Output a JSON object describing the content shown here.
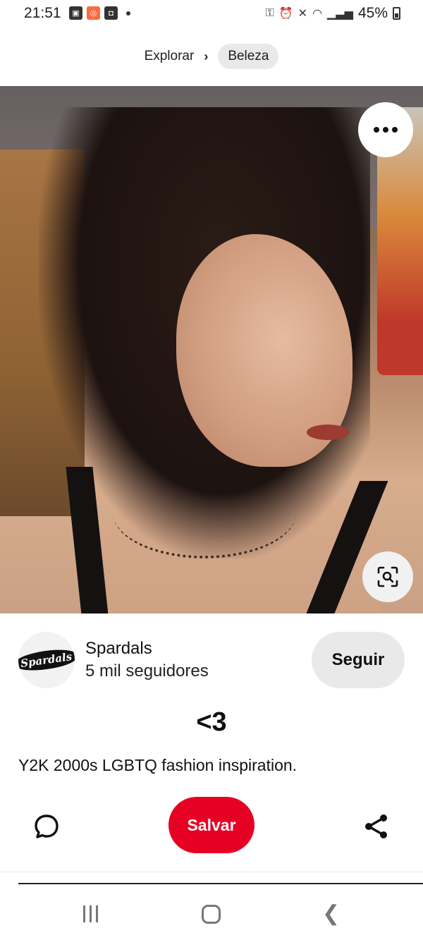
{
  "status_bar": {
    "time": "21:51",
    "battery": "45%",
    "left_icons": [
      "gallery-icon",
      "app-notification-icon",
      "box-icon",
      "dot-icon"
    ],
    "right_icons": [
      "lock-icon",
      "alarm-icon",
      "mute-icon",
      "wifi-icon",
      "signal-icon",
      "battery-icon"
    ]
  },
  "breadcrumb": {
    "parent": "Explorar",
    "current": "Beleza"
  },
  "pin": {
    "image_alt_icon": "photo",
    "more_icon": "ellipsis-icon",
    "lens_icon": "visual-search-icon"
  },
  "author": {
    "avatar_text": "Spardals",
    "name": "Spardals",
    "followers": "5 mil seguidores",
    "follow_label": "Seguir"
  },
  "title": "<3",
  "description": "Y2K 2000s LGBTQ fashion inspiration.",
  "actions": {
    "comment_icon": "comment-icon",
    "save_label": "Salvar",
    "share_icon": "share-icon"
  },
  "colors": {
    "save_red": "#e60023",
    "pill_gray": "#e9e9e9"
  }
}
